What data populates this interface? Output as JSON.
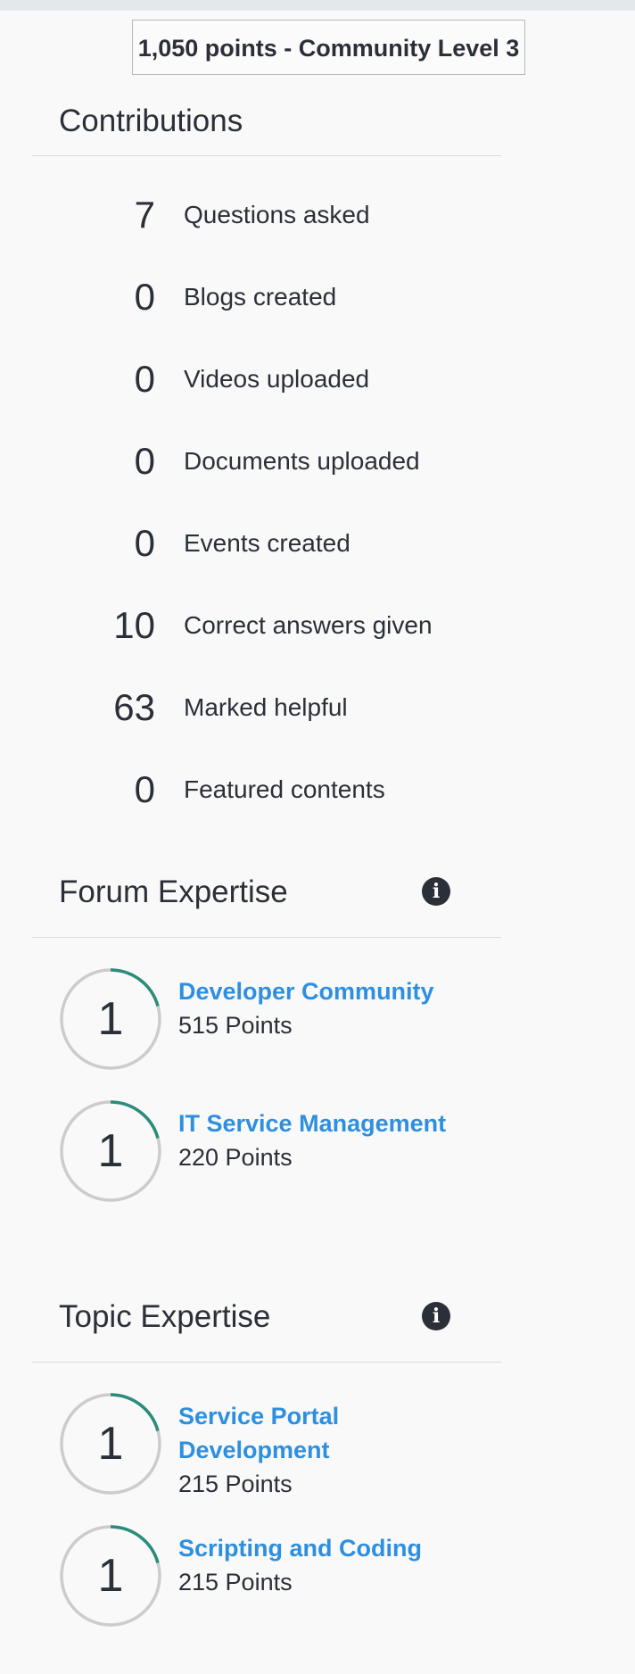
{
  "points_badge": "1,050 points - Community Level 3",
  "contributions": {
    "title": "Contributions",
    "items": [
      {
        "count": "7",
        "label": "Questions asked"
      },
      {
        "count": "0",
        "label": "Blogs created"
      },
      {
        "count": "0",
        "label": "Videos uploaded"
      },
      {
        "count": "0",
        "label": "Documents uploaded"
      },
      {
        "count": "0",
        "label": "Events created"
      },
      {
        "count": "10",
        "label": "Correct answers given"
      },
      {
        "count": "63",
        "label": "Marked helpful"
      },
      {
        "count": "0",
        "label": "Featured contents"
      }
    ]
  },
  "forum_expertise": {
    "title": "Forum Expertise",
    "info_icon": "info-icon",
    "items": [
      {
        "rank": "1",
        "name": "Developer Community",
        "points": "515 Points"
      },
      {
        "rank": "1",
        "name": "IT Service Management",
        "points": "220 Points"
      }
    ]
  },
  "topic_expertise": {
    "title": "Topic Expertise",
    "info_icon": "info-icon",
    "items": [
      {
        "rank": "1",
        "name": "Service Portal Development",
        "points": "215 Points"
      },
      {
        "rank": "1",
        "name": "Scripting and Coding",
        "points": "215 Points"
      }
    ]
  },
  "colors": {
    "link": "#2e8fe0",
    "ring_track": "#cccccc",
    "ring_progress": "#2a8c7a",
    "text": "#2b2f38"
  }
}
